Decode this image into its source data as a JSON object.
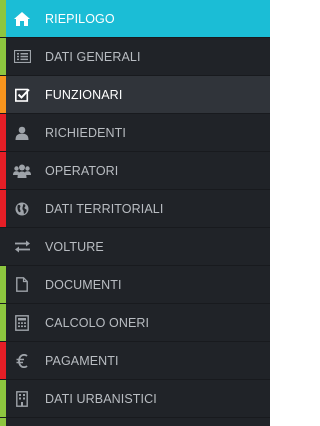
{
  "sidebar": {
    "items": [
      {
        "label": "RIEPILOGO",
        "icon": "home-icon",
        "accent": "#8dc63f",
        "state": "active"
      },
      {
        "label": "DATI GENERALI",
        "icon": "list-icon",
        "accent": "#8dc63f",
        "state": "normal"
      },
      {
        "label": "FUNZIONARI",
        "icon": "checkbox-icon",
        "accent": "#f7941d",
        "state": "selected"
      },
      {
        "label": "RICHIEDENTI",
        "icon": "user-icon",
        "accent": "#e61e26",
        "state": "normal"
      },
      {
        "label": "OPERATORI",
        "icon": "users-icon",
        "accent": "#e61e26",
        "state": "normal"
      },
      {
        "label": "DATI TERRITORIALI",
        "icon": "globe-icon",
        "accent": "#e61e26",
        "state": "normal"
      },
      {
        "label": "VOLTURE",
        "icon": "exchange-icon",
        "accent": "",
        "state": "normal"
      },
      {
        "label": "DOCUMENTI",
        "icon": "document-icon",
        "accent": "#8dc63f",
        "state": "normal"
      },
      {
        "label": "CALCOLO ONERI",
        "icon": "calculator-icon",
        "accent": "#8dc63f",
        "state": "normal"
      },
      {
        "label": "PAGAMENTI",
        "icon": "euro-icon",
        "accent": "#e61e26",
        "state": "normal"
      },
      {
        "label": "DATI URBANISTICI",
        "icon": "building-icon",
        "accent": "#8dc63f",
        "state": "normal"
      }
    ]
  },
  "colors": {
    "sidebar_bg": "#202328",
    "active_bg": "#1bbdd6",
    "selected_bg": "#30343a",
    "label_color": "#b9bdc2",
    "icon_color": "#9ea3a9"
  }
}
